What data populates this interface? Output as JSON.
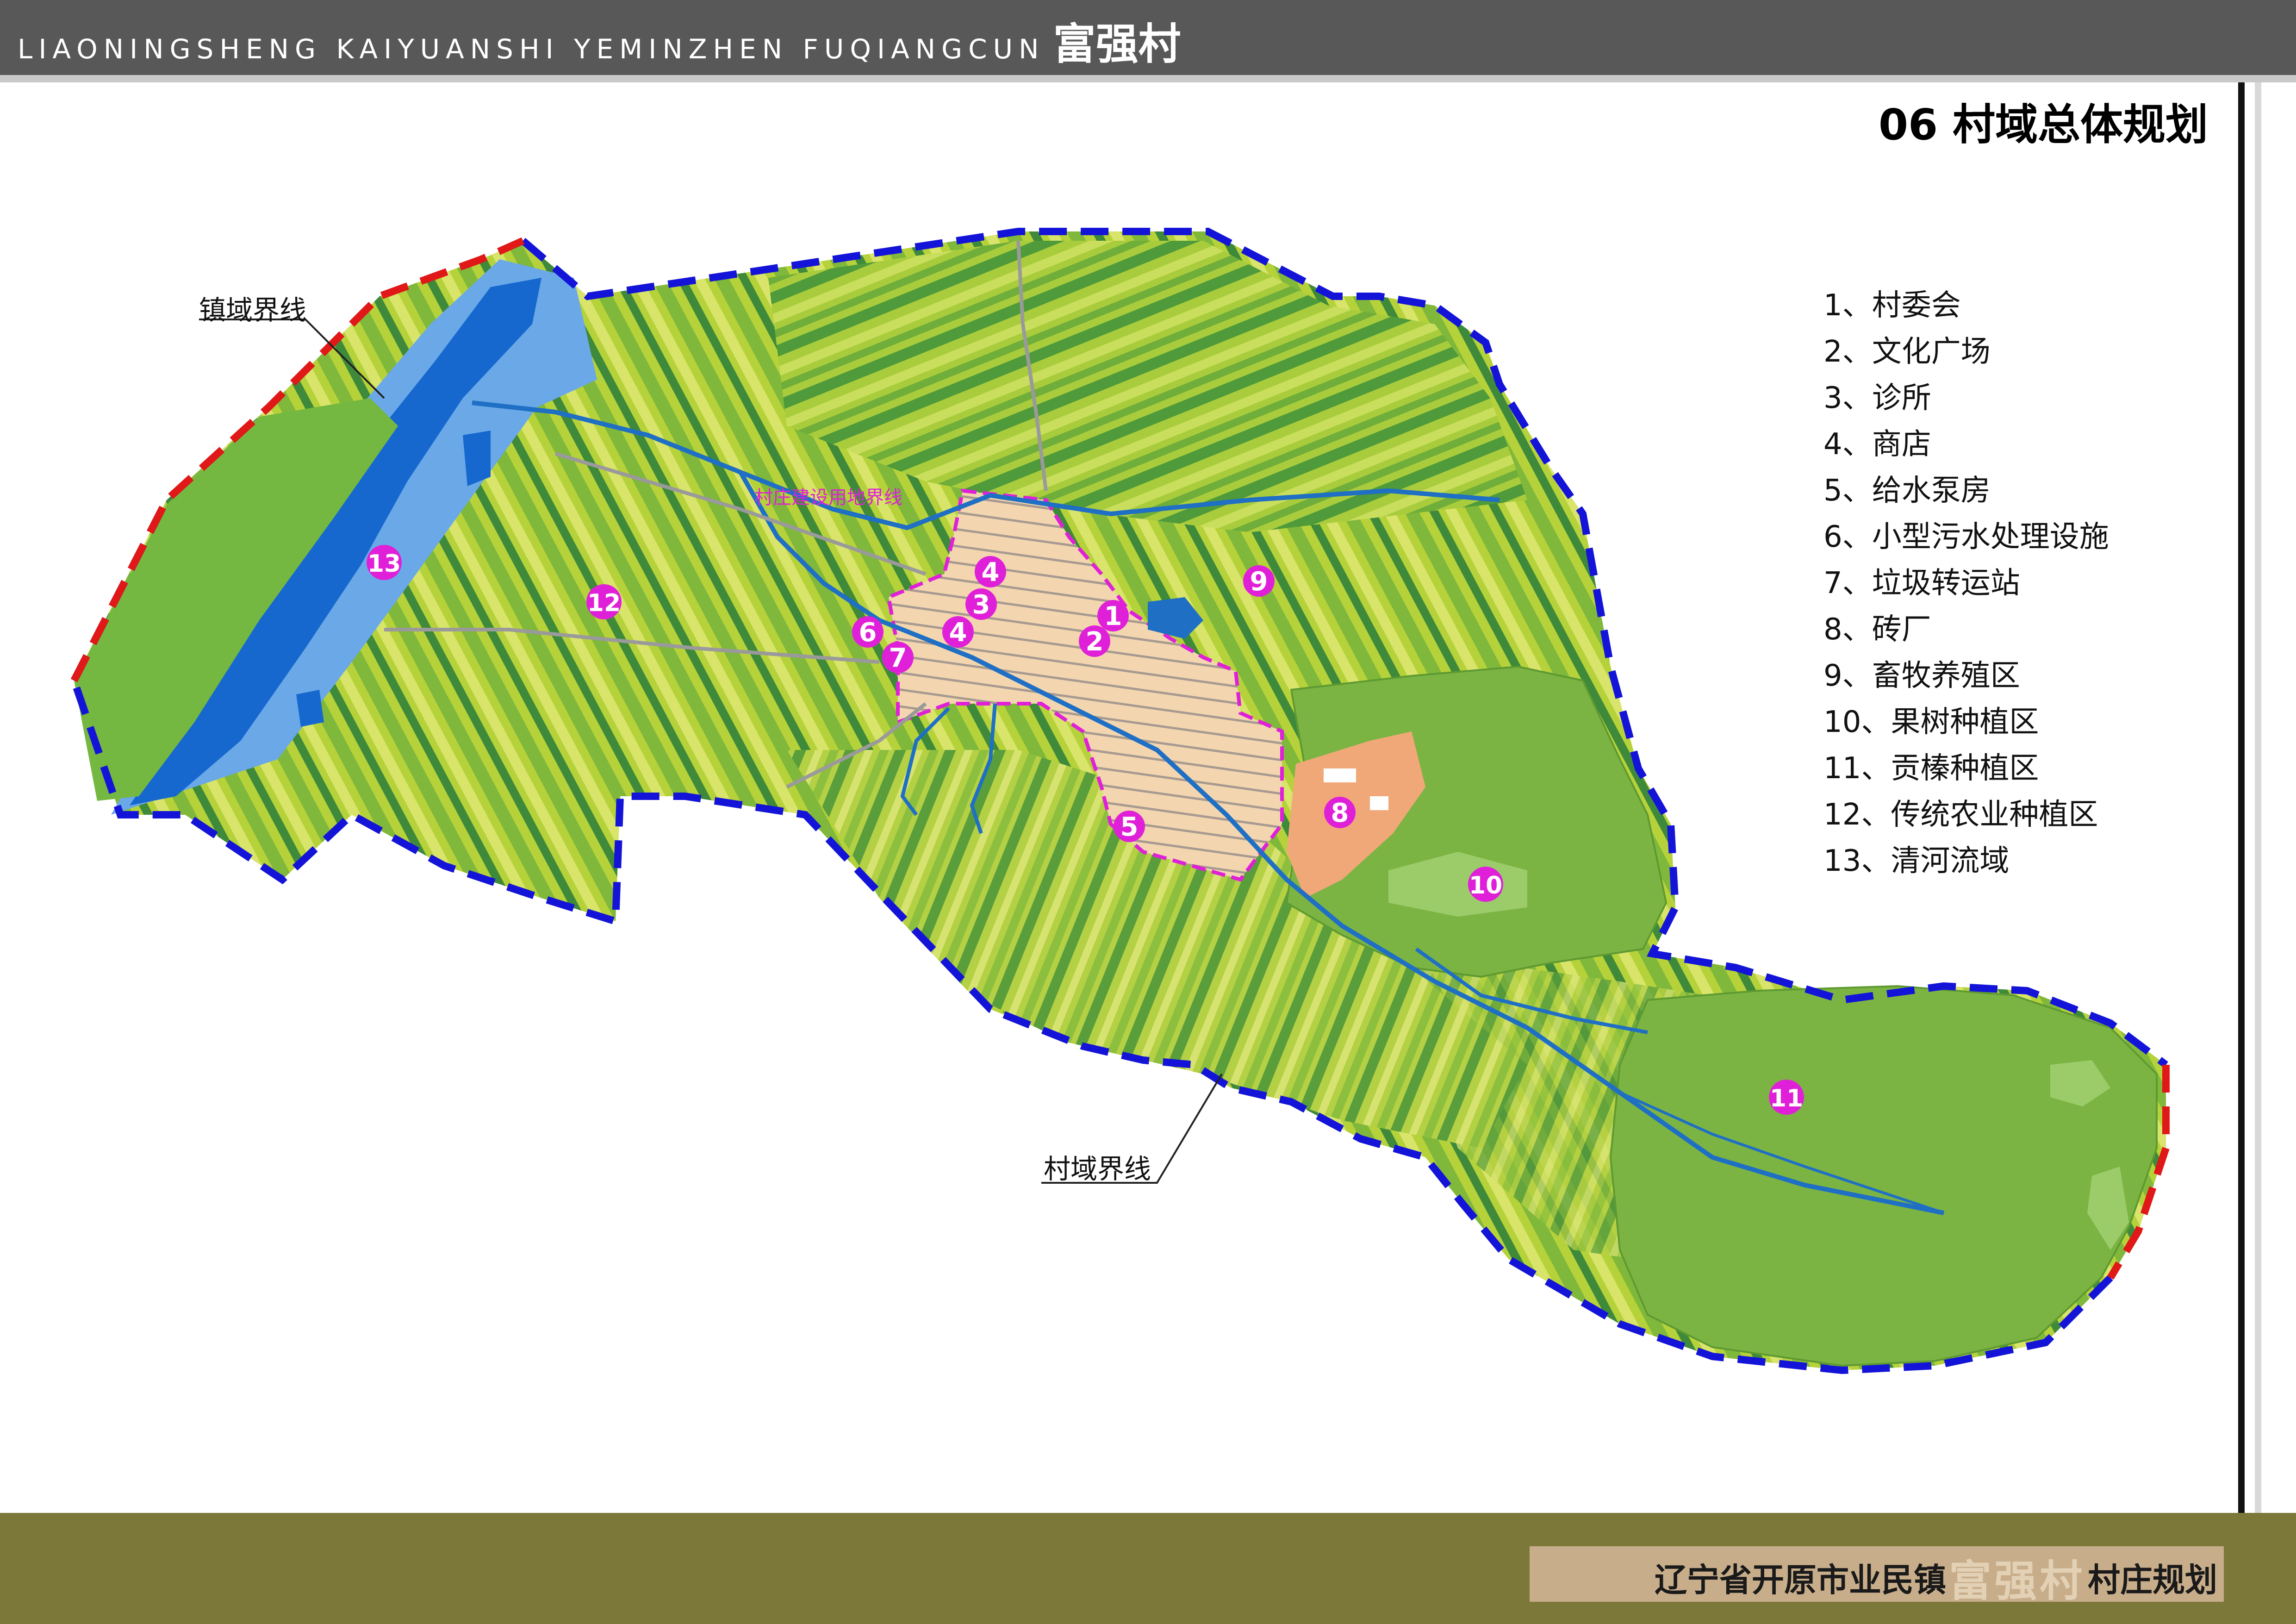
{
  "header": {
    "latin_title": "LIAONINGSHENG KAIYUANSHI YEMINZHEN FUQIANGCUN",
    "cn_title": "富强村"
  },
  "section_title": "06 村域总体规划",
  "legend": {
    "items": [
      "1、村委会",
      "2、文化广场",
      "3、诊所",
      "4、商店",
      "5、给水泵房",
      "6、小型污水处理设施",
      "7、垃圾转运站",
      "8、砖厂",
      "9、畜牧养殖区",
      "10、果树种植区",
      "11、贡榛种植区",
      "12、传统农业种植区",
      "13、清河流域"
    ]
  },
  "map": {
    "labels": {
      "town_boundary": "镇域界线",
      "village_boundary": "村域界线",
      "construction_boundary": "村庄建设用地界线"
    },
    "markers": [
      "1",
      "2",
      "3",
      "4",
      "4",
      "4",
      "5",
      "6",
      "7",
      "8",
      "9",
      "10",
      "11",
      "12",
      "13"
    ],
    "colors": {
      "marker": "#e020d8",
      "village_boundary": "#1414d8",
      "town_boundary": "#e01818",
      "river": "#1f6fc4",
      "construction_land": "#f3d6b0",
      "brick_factory": "#f0a878",
      "fields_light": "#b8d43a",
      "fields_dark": "#3f8a3a"
    }
  },
  "footer": {
    "prefix": "辽宁省开原市业民镇",
    "highlight": "富强村",
    "suffix": "村庄规划"
  }
}
